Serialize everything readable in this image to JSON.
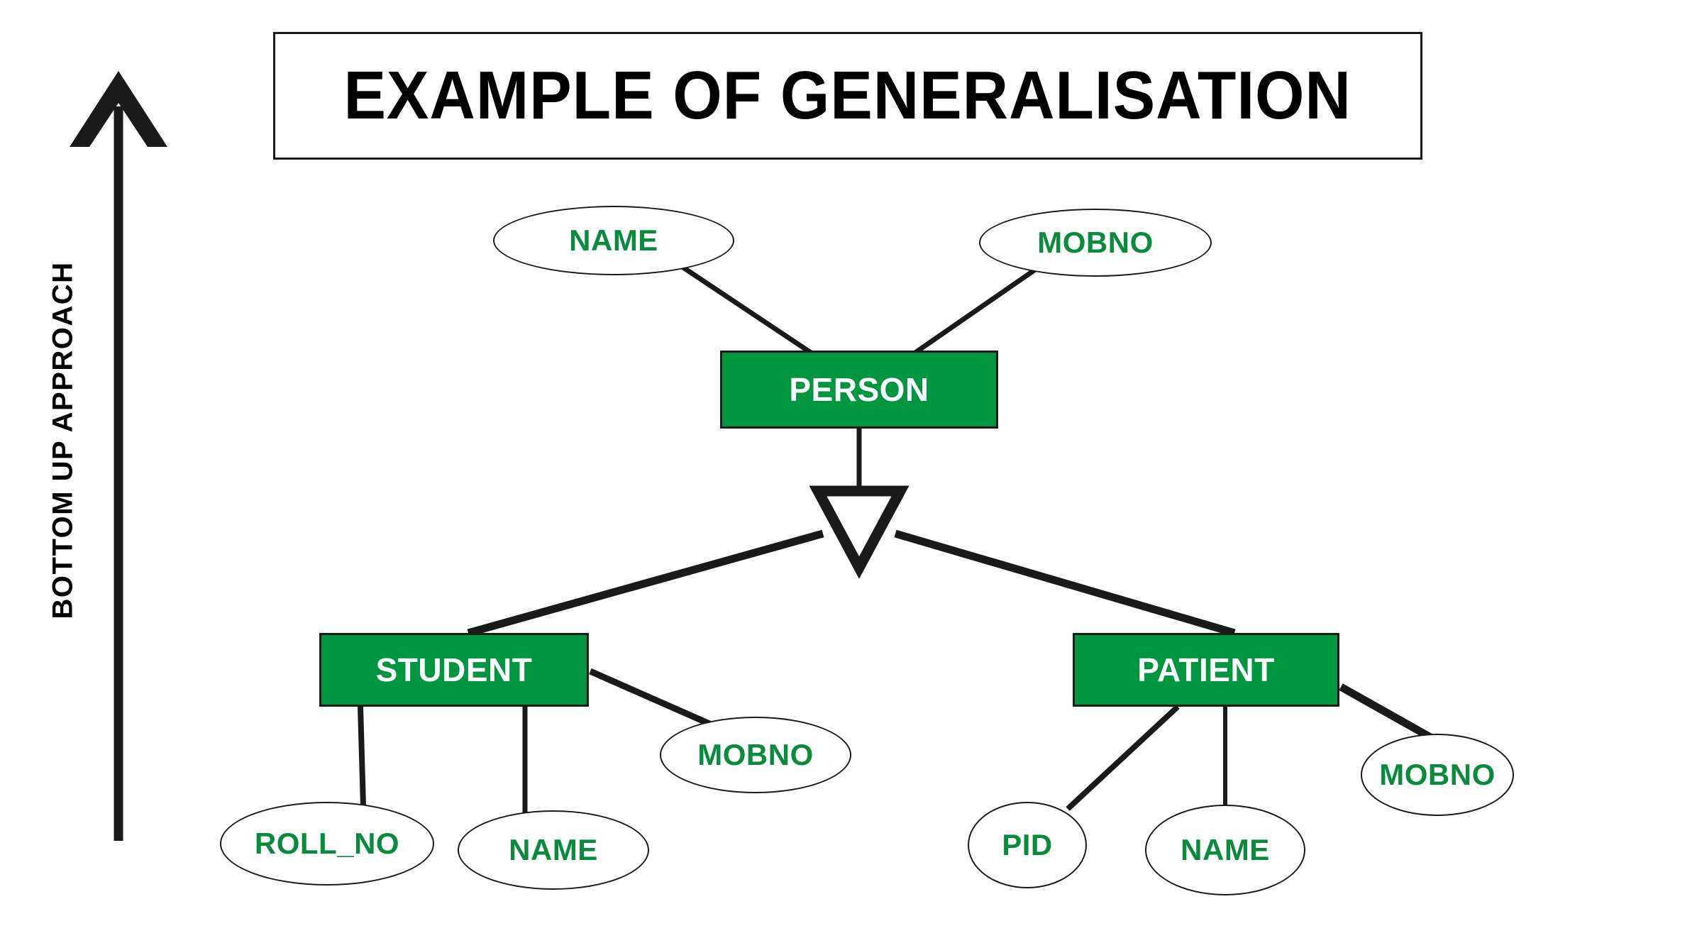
{
  "page": {
    "title": "EXAMPLE OF GENERALISATION",
    "background_color": "#ffffff"
  },
  "axis": {
    "label": "BOTTOM UP APPROACH",
    "arrow_direction": "up",
    "arrow_icon": "up-arrow-icon"
  },
  "colors": {
    "entity_fill": "#009640",
    "entity_text": "#ffffff",
    "attribute_text": "#0a8a3c",
    "attribute_fill": "#ffffff",
    "stroke": "#1a1a1a"
  },
  "chart_data": {
    "type": "diagram",
    "diagram_kind": "er-generalisation",
    "title": "EXAMPLE OF GENERALISATION",
    "annotations": [
      "BOTTOM UP APPROACH"
    ],
    "entities": [
      {
        "id": "person",
        "label": "PERSON",
        "role": "superclass",
        "attributes": [
          "NAME",
          "MOBNO"
        ]
      },
      {
        "id": "student",
        "label": "STUDENT",
        "role": "subclass",
        "attributes": [
          "ROLL_NO",
          "NAME",
          "MOBNO"
        ]
      },
      {
        "id": "patient",
        "label": "PATIENT",
        "role": "subclass",
        "attributes": [
          "PID",
          "NAME",
          "MOBNO"
        ]
      }
    ],
    "relationships": [
      {
        "from": "person",
        "to": "student",
        "type": "generalisation",
        "symbol": "triangle"
      },
      {
        "from": "person",
        "to": "patient",
        "type": "generalisation",
        "symbol": "triangle"
      }
    ]
  },
  "entities": {
    "person": {
      "label": "PERSON"
    },
    "student": {
      "label": "STUDENT"
    },
    "patient": {
      "label": "PATIENT"
    }
  },
  "attributes": {
    "person_name": {
      "label": "NAME"
    },
    "person_mobno": {
      "label": "MOBNO"
    },
    "student_rollno": {
      "label": "ROLL_NO"
    },
    "student_name": {
      "label": "NAME"
    },
    "student_mobno": {
      "label": "MOBNO"
    },
    "patient_pid": {
      "label": "PID"
    },
    "patient_name": {
      "label": "NAME"
    },
    "patient_mobno": {
      "label": "MOBNO"
    }
  },
  "symbols": {
    "generalisation_triangle": "triangle-down-icon"
  }
}
